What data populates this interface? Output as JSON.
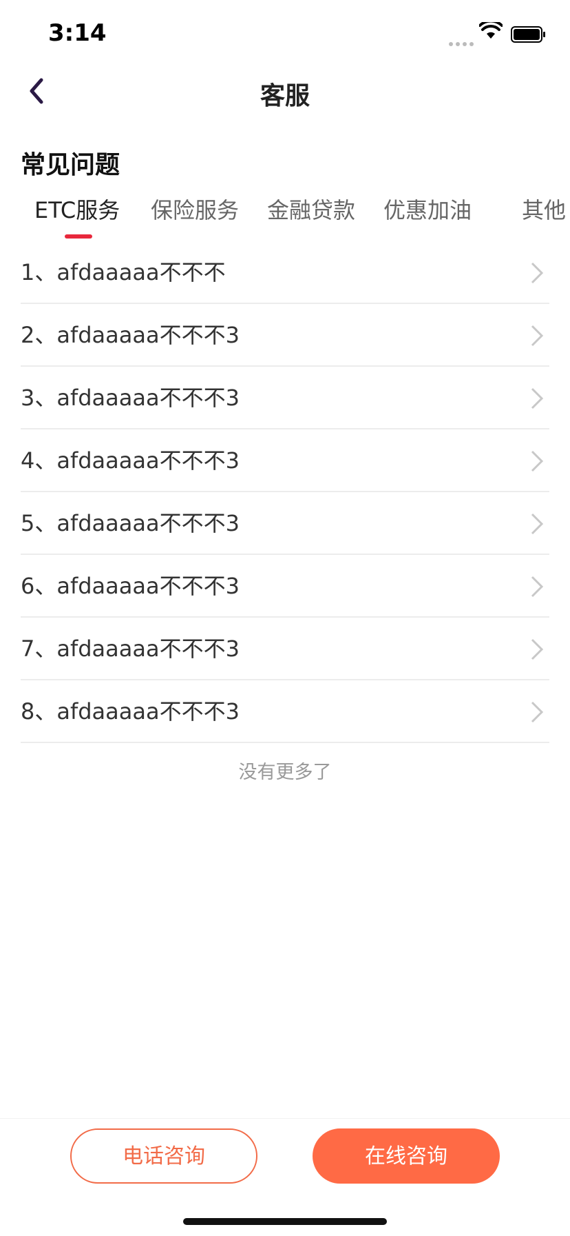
{
  "status_bar": {
    "time": "3:14"
  },
  "nav": {
    "title": "客服"
  },
  "section": {
    "title": "常见问题"
  },
  "tabs": [
    {
      "label": "ETC服务",
      "active": true
    },
    {
      "label": "保险服务",
      "active": false
    },
    {
      "label": "金融贷款",
      "active": false
    },
    {
      "label": "优惠加油",
      "active": false
    },
    {
      "label": "其他",
      "active": false
    }
  ],
  "faq": [
    "1、afdaaaaa不不不",
    "2、afdaaaaa不不不3",
    "3、afdaaaaa不不不3",
    "4、afdaaaaa不不不3",
    "5、afdaaaaa不不不3",
    "6、afdaaaaa不不不3",
    "7、afdaaaaa不不不3",
    "8、afdaaaaa不不不3"
  ],
  "list_footer": "没有更多了",
  "buttons": {
    "phone": "电话咨询",
    "online": "在线咨询"
  },
  "colors": {
    "accent": "#ff6a45",
    "tab_indicator": "#e8283c",
    "back_icon": "#2b1a45"
  },
  "icons": {
    "back": "chevron-left-icon",
    "row": "chevron-right-icon",
    "wifi": "wifi-icon",
    "battery": "battery-icon"
  }
}
